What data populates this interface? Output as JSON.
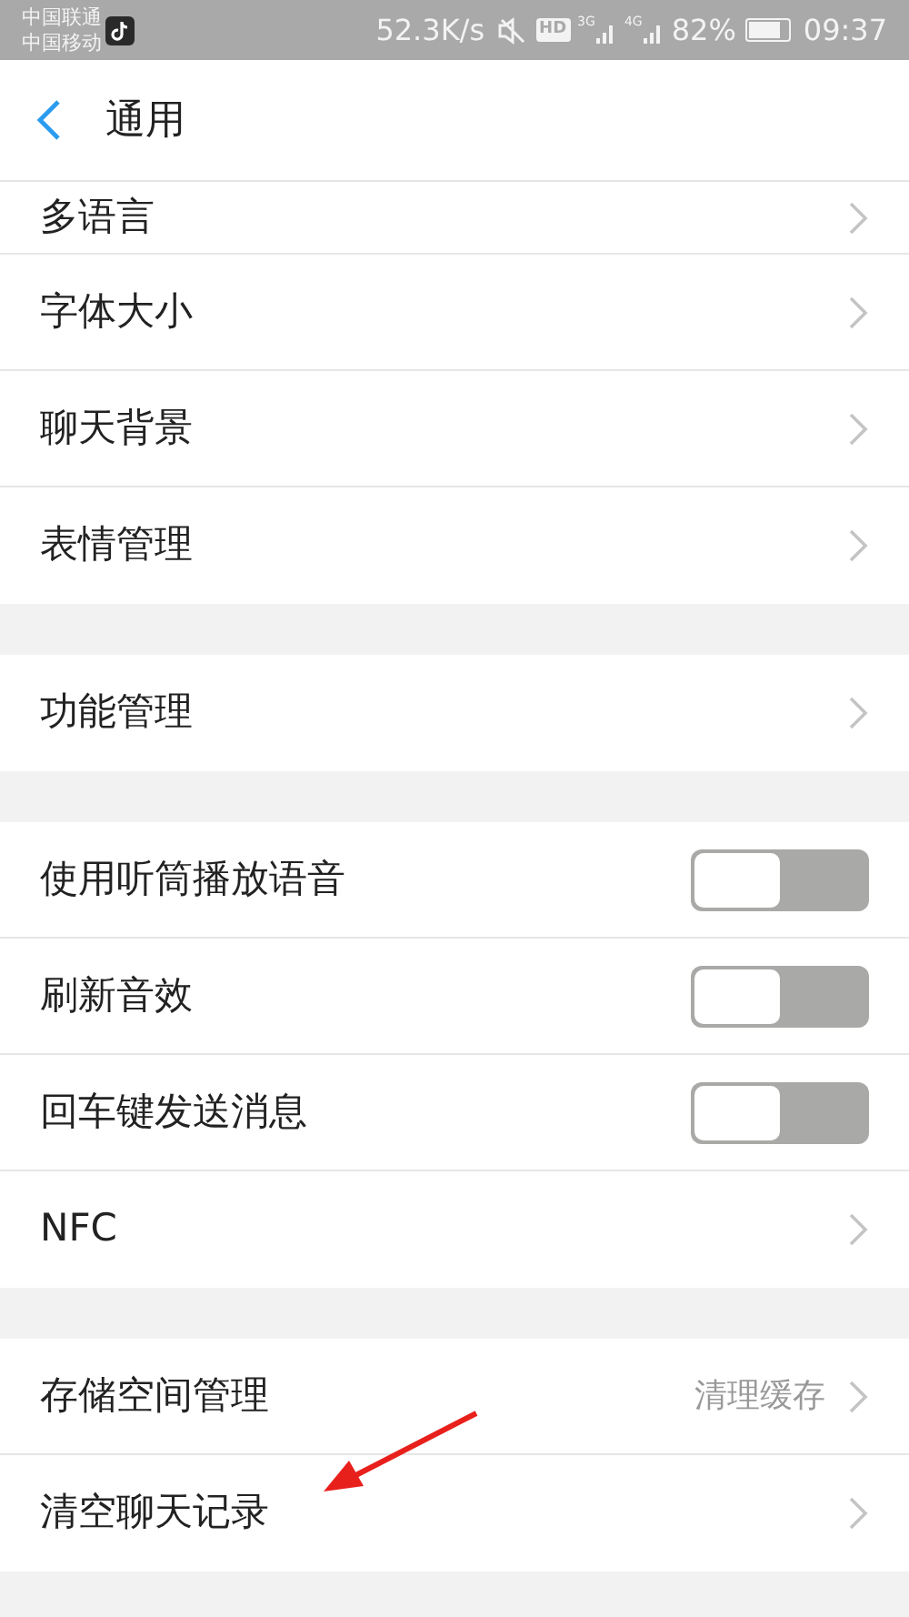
{
  "status_bar": {
    "carriers": [
      "中国联通",
      "中国移动"
    ],
    "speed": "52.3K/s",
    "hd": "HD",
    "net1": "3G",
    "net2": "4G",
    "battery": "82%",
    "time": "09:37"
  },
  "header": {
    "title": "通用"
  },
  "groups": [
    {
      "items": [
        {
          "kind": "link",
          "label": "多语言"
        },
        {
          "kind": "link",
          "label": "字体大小"
        },
        {
          "kind": "link",
          "label": "聊天背景"
        },
        {
          "kind": "link",
          "label": "表情管理"
        }
      ]
    },
    {
      "items": [
        {
          "kind": "link",
          "label": "功能管理"
        }
      ]
    },
    {
      "items": [
        {
          "kind": "toggle",
          "label": "使用听筒播放语音",
          "on": false
        },
        {
          "kind": "toggle",
          "label": "刷新音效",
          "on": false
        },
        {
          "kind": "toggle",
          "label": "回车键发送消息",
          "on": false
        },
        {
          "kind": "link",
          "label": "NFC"
        }
      ]
    },
    {
      "items": [
        {
          "kind": "link",
          "label": "存储空间管理",
          "value": "清理缓存"
        },
        {
          "kind": "link",
          "label": "清空聊天记录"
        }
      ]
    }
  ],
  "annotation": {
    "kind": "arrow"
  }
}
